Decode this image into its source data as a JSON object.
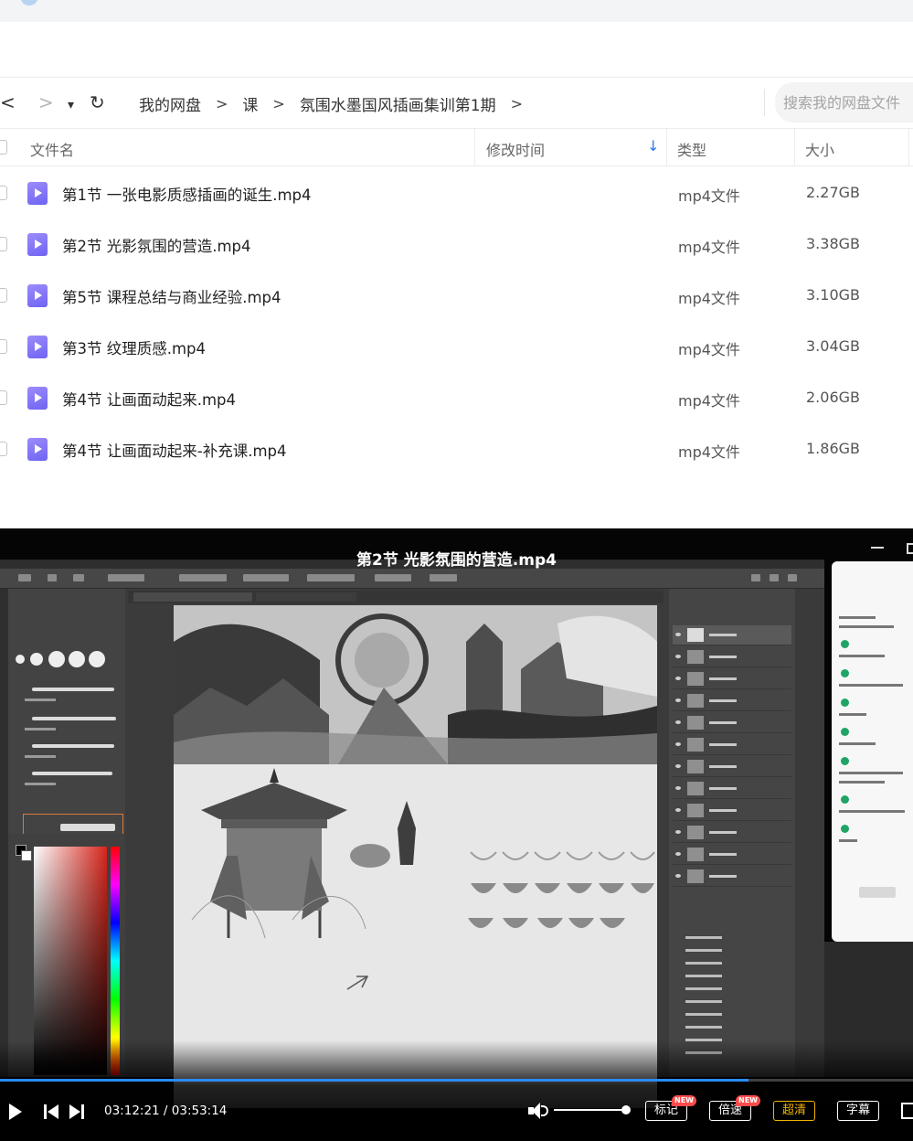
{
  "breadcrumb": {
    "items": [
      "我的网盘",
      "课",
      "氛围水墨国风插画集训第1期"
    ],
    "separator": ">"
  },
  "nav": {
    "back": "<",
    "forward": ">",
    "dropdown": "▾",
    "refresh": "↻"
  },
  "search": {
    "placeholder": "搜索我的网盘文件"
  },
  "table": {
    "columns": {
      "name": "文件名",
      "modified": "修改时间",
      "type": "类型",
      "size": "大小"
    },
    "sort_arrow": "↓",
    "rows": [
      {
        "name": "第1节 一张电影质感插画的诞生.mp4",
        "type": "mp4文件",
        "size": "2.27GB"
      },
      {
        "name": "第2节 光影氛围的营造.mp4",
        "type": "mp4文件",
        "size": "3.38GB"
      },
      {
        "name": "第5节 课程总结与商业经验.mp4",
        "type": "mp4文件",
        "size": "3.10GB"
      },
      {
        "name": "第3节 纹理质感.mp4",
        "type": "mp4文件",
        "size": "3.04GB"
      },
      {
        "name": "第4节 让画面动起来.mp4",
        "type": "mp4文件",
        "size": "2.06GB"
      },
      {
        "name": "第4节 让画面动起来-补充课.mp4",
        "type": "mp4文件",
        "size": "1.86GB"
      }
    ]
  },
  "player": {
    "title": "第2节 光影氛围的营造.mp4",
    "time": "03:12:21 / 03:53:14",
    "progress": 0.8202,
    "volume": 1.0,
    "buttons": {
      "mark": "标记",
      "speed": "倍速",
      "quality": "超清",
      "subtitle": "字幕"
    },
    "new_badge": "NEW",
    "accent_color": "#2a8cff",
    "quality_color": "#f0b400"
  },
  "colors": {
    "file_icon": "#7b6ff5",
    "sort_arrow": "#2b7bf0"
  }
}
